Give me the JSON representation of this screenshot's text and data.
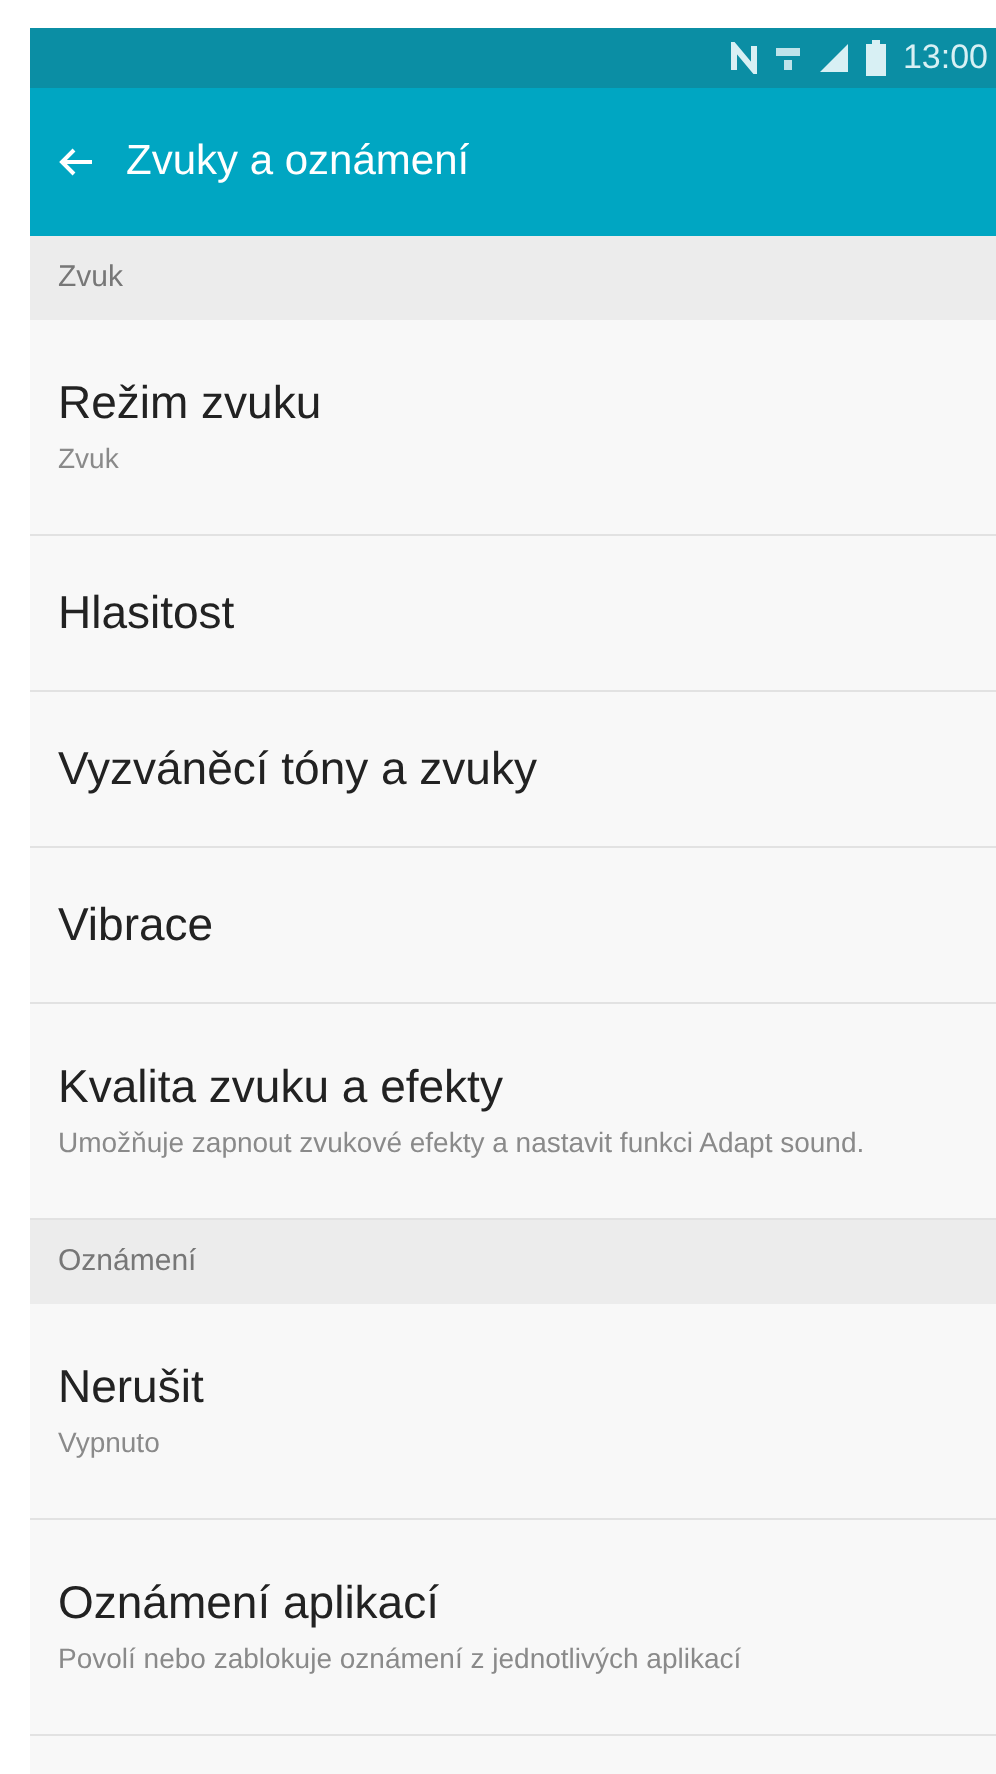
{
  "status_bar": {
    "time": "13:00"
  },
  "app_bar": {
    "title": "Zvuky a oznámení"
  },
  "sections": [
    {
      "header": "Zvuk",
      "items": [
        {
          "title": "Režim zvuku",
          "subtitle": "Zvuk"
        },
        {
          "title": "Hlasitost"
        },
        {
          "title": "Vyzváněcí tóny a zvuky"
        },
        {
          "title": "Vibrace"
        },
        {
          "title": "Kvalita zvuku a efekty",
          "subtitle": "Umožňuje zapnout zvukové efekty a nastavit funkci Adapt sound."
        }
      ]
    },
    {
      "header": "Oznámení",
      "items": [
        {
          "title": "Nerušit",
          "subtitle": "Vypnuto"
        },
        {
          "title": "Oznámení aplikací",
          "subtitle": "Povolí nebo zablokuje oznámení z jednotlivých aplikací"
        }
      ]
    }
  ]
}
